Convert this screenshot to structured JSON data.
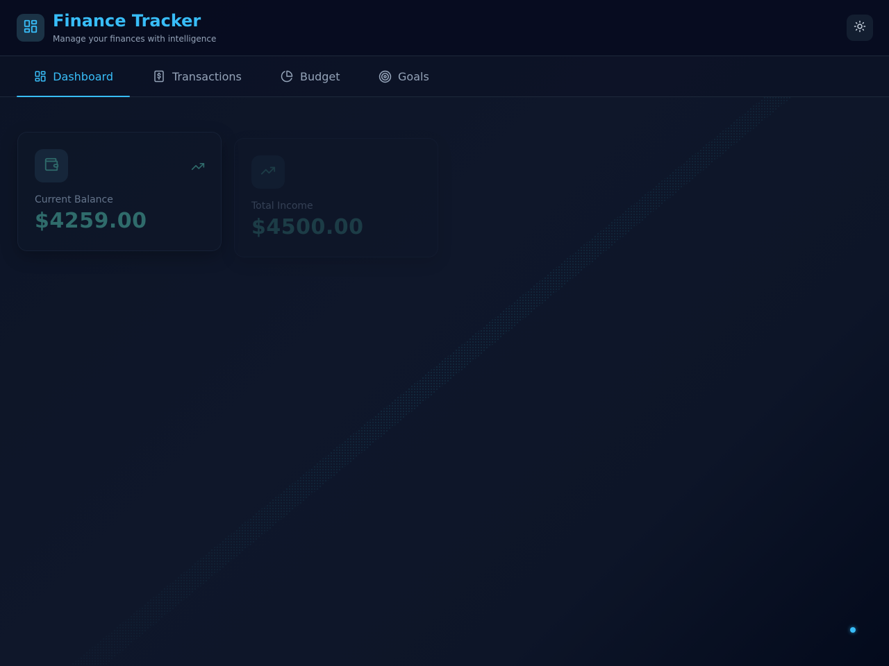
{
  "app": {
    "title": "Finance Tracker",
    "subtitle": "Manage your finances with intelligence"
  },
  "header": {
    "logo_icon": "dashboard-grid-icon",
    "theme_toggle_icon": "sun-icon"
  },
  "tabs": [
    {
      "label": "Dashboard",
      "icon": "dashboard-grid-icon",
      "active": true
    },
    {
      "label": "Transactions",
      "icon": "dollar-receipt-icon",
      "active": false
    },
    {
      "label": "Budget",
      "icon": "pie-chart-icon",
      "active": false
    },
    {
      "label": "Goals",
      "icon": "target-icon",
      "active": false
    }
  ],
  "cards": [
    {
      "label": "Current Balance",
      "value": "$4259.00",
      "icon": "wallet-icon",
      "trend_icon": "trending-up-icon"
    },
    {
      "label": "Total Income",
      "value": "$4500.00",
      "icon": "trending-up-icon"
    }
  ],
  "colors": {
    "accent": "#38bdf8",
    "background": "#0f172a",
    "value_text": "#2f6b6b"
  }
}
